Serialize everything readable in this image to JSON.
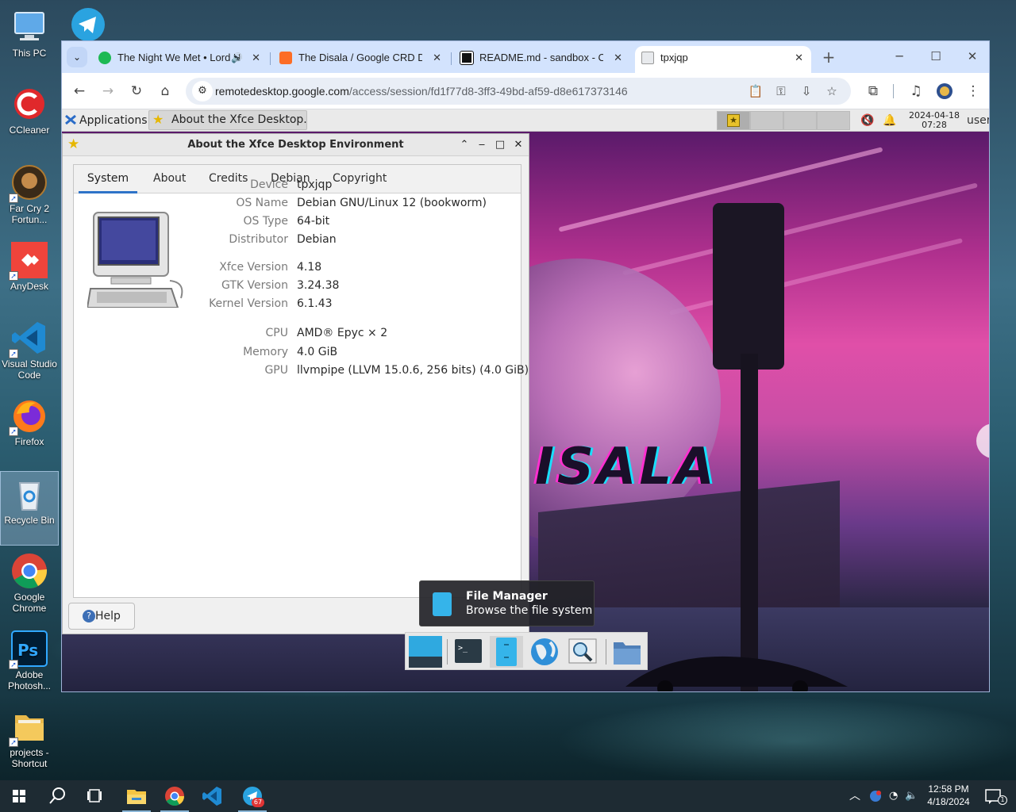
{
  "desktop": {
    "icons": [
      {
        "label": "This PC",
        "icon": "this-pc-icon"
      },
      {
        "label": "CCleaner",
        "icon": "ccleaner-icon"
      },
      {
        "label": "Far Cry 2 Fortun...",
        "icon": "far-cry-icon"
      },
      {
        "label": "AnyDesk",
        "icon": "anydesk-icon"
      },
      {
        "label": "Visual Studio Code",
        "icon": "vscode-icon"
      },
      {
        "label": "Firefox",
        "icon": "firefox-icon"
      },
      {
        "label": "Recycle Bin",
        "icon": "recycle-bin-icon"
      },
      {
        "label": "Google Chrome",
        "icon": "chrome-icon"
      },
      {
        "label": "Adobe Photosh...",
        "icon": "photoshop-icon"
      },
      {
        "label": "projects - Shortcut",
        "icon": "folder-icon"
      }
    ],
    "telegram_icon": "telegram-icon"
  },
  "browser": {
    "tabs": [
      {
        "title": "The Night We Met • Lord Huron",
        "favicon": "spotify-icon",
        "audio": true
      },
      {
        "title": "The Disala / Google CRD Debian",
        "favicon": "gitlab-icon"
      },
      {
        "title": "README.md - sandbox - Code",
        "favicon": "codesandbox-icon"
      },
      {
        "title": "tpxjqp",
        "favicon": "remote-desktop-icon",
        "active": true
      }
    ],
    "url_host": "remotedesktop.google.com",
    "url_path": "/access/session/fd1f77d8-3ff3-49bd-af59-d8e617373146",
    "accent": "#d3e3fd"
  },
  "xfce": {
    "panel": {
      "applications": "Applications",
      "task_title": "About the Xfce Desktop...",
      "clock_date": "2024-04-18",
      "clock_time": "07:28",
      "user": "user"
    },
    "about": {
      "title": "About the Xfce Desktop Environment",
      "tabs": [
        "System",
        "About",
        "Credits",
        "Debian",
        "Copyright"
      ],
      "active_tab": "System",
      "rows": [
        {
          "key": "Device",
          "value": "tpxjqp"
        },
        {
          "key": "OS Name",
          "value": "Debian GNU/Linux 12 (bookworm)"
        },
        {
          "key": "OS Type",
          "value": "64-bit"
        },
        {
          "key": "Distributor",
          "value": "Debian"
        },
        {
          "key": "Xfce Version",
          "value": "4.18"
        },
        {
          "key": "GTK Version",
          "value": "3.24.38"
        },
        {
          "key": "Kernel Version",
          "value": "6.1.43"
        },
        {
          "key": "CPU",
          "value": "AMD® Epyc × 2"
        },
        {
          "key": "Memory",
          "value": "4.0 GiB"
        },
        {
          "key": "GPU",
          "value": "llvmpipe (LLVM 15.0.6, 256 bits) (4.0 GiB)"
        }
      ],
      "help_label": "Help"
    },
    "wallpaper_text": "ISALA",
    "tooltip": {
      "title": "File Manager",
      "subtitle": "Browse the file system"
    },
    "dock": [
      "show-desktop-icon",
      "terminal-icon",
      "file-manager-icon",
      "web-browser-icon",
      "app-finder-icon",
      "home-folder-icon"
    ]
  },
  "taskbar": {
    "items": [
      "start-icon",
      "search-icon",
      "task-view-icon",
      "file-explorer-icon",
      "chrome-icon",
      "vscode-icon",
      "telegram-icon"
    ],
    "telegram_badge": "67",
    "time": "12:58 PM",
    "date": "4/18/2024",
    "notifications": "1"
  }
}
